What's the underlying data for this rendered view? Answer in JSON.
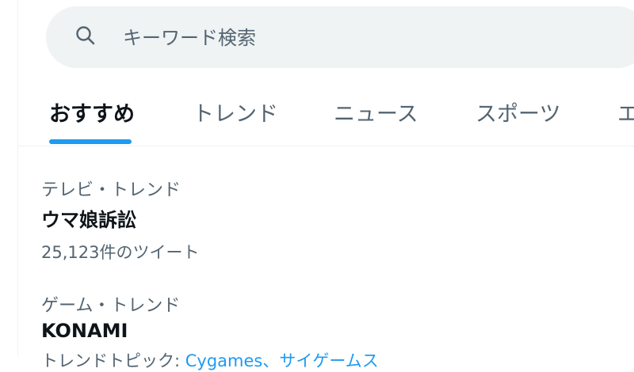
{
  "search": {
    "placeholder": "キーワード検索",
    "icon": "search-icon"
  },
  "tabs": [
    {
      "label": "おすすめ",
      "active": true
    },
    {
      "label": "トレンド",
      "active": false
    },
    {
      "label": "ニュース",
      "active": false
    },
    {
      "label": "スポーツ",
      "active": false
    },
    {
      "label": "エ",
      "active": false
    }
  ],
  "trends": [
    {
      "category": "テレビ・トレンド",
      "title": "ウマ娘訴訟",
      "count": "25,123件のツイート"
    },
    {
      "category": "ゲーム・トレンド",
      "title": "KONAMI",
      "partial_prefix": "トレンドトピック:",
      "partial_link": "Cygames、サイゲームス"
    }
  ],
  "colors": {
    "accent": "#1d9bf0",
    "text_primary": "#0f1419",
    "text_secondary": "#536471",
    "search_bg": "#eff3f4"
  }
}
